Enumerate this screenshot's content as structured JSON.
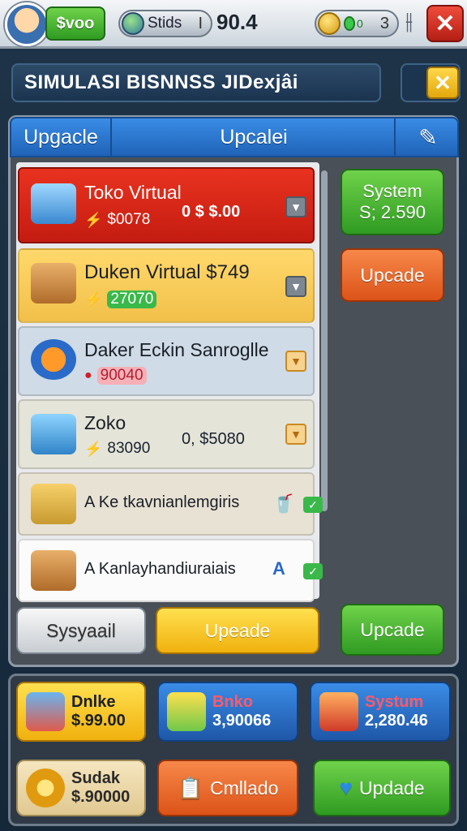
{
  "topbar": {
    "cash_label": "$voo",
    "stat_label": "Stids",
    "stat_separator": "I",
    "stat_value": "90.4",
    "coin_gem_value": "0",
    "coin_count": "3",
    "settings_glyph": "⫲",
    "close_glyph": "✕"
  },
  "title": {
    "text": "SIMULASI BISNNSS JIDexjâi",
    "close_glyph": "✕"
  },
  "tabs": {
    "tab1": "Upgacle",
    "tab2": "Upcalei",
    "tool_glyph": "✎"
  },
  "rows": [
    {
      "name": "Toko Virtual",
      "sub": "$0078",
      "price": "0 $ $.00",
      "icon": "shopping-cart-icon"
    },
    {
      "name": "Duken Virtual $749",
      "sub": "27070",
      "icon": "cardboard-box-icon"
    },
    {
      "name": "Daker Eckin Sanroglle",
      "sub": "90040",
      "icon": "disc-toy-icon"
    },
    {
      "name": "Zoko",
      "sub": "83090",
      "price": "0, $5080",
      "icon": "blue-box-icon"
    },
    {
      "name": "A Ke tkavnianlemgiris",
      "icon": "parcel-box-icon"
    },
    {
      "name": "A Kanlayhandiuraiais",
      "icon": "gift-box-icon"
    }
  ],
  "side": {
    "system_title": "System",
    "system_value": "S; 2.590",
    "upgrade_label": "Upcade",
    "bottom_green_label": "Upcade"
  },
  "actions": {
    "grey_label": "Sysyaail",
    "yellow_label": "Upeade"
  },
  "shop": [
    {
      "title": "Dnlke",
      "value": "$.99.00",
      "icon": "storefront-icon"
    },
    {
      "title": "Bnko",
      "value": "3,90066",
      "icon": "fruit-cart-icon"
    },
    {
      "title": "Systum",
      "value": "2,280.46",
      "icon": "food-bowl-icon"
    }
  ],
  "footer": {
    "card_title": "Sudak",
    "card_value": "$.90000",
    "card_icon": "gear-icon",
    "orange_label": "Cmllado",
    "green_label": "Updade",
    "green_icon": "heart-icon"
  }
}
